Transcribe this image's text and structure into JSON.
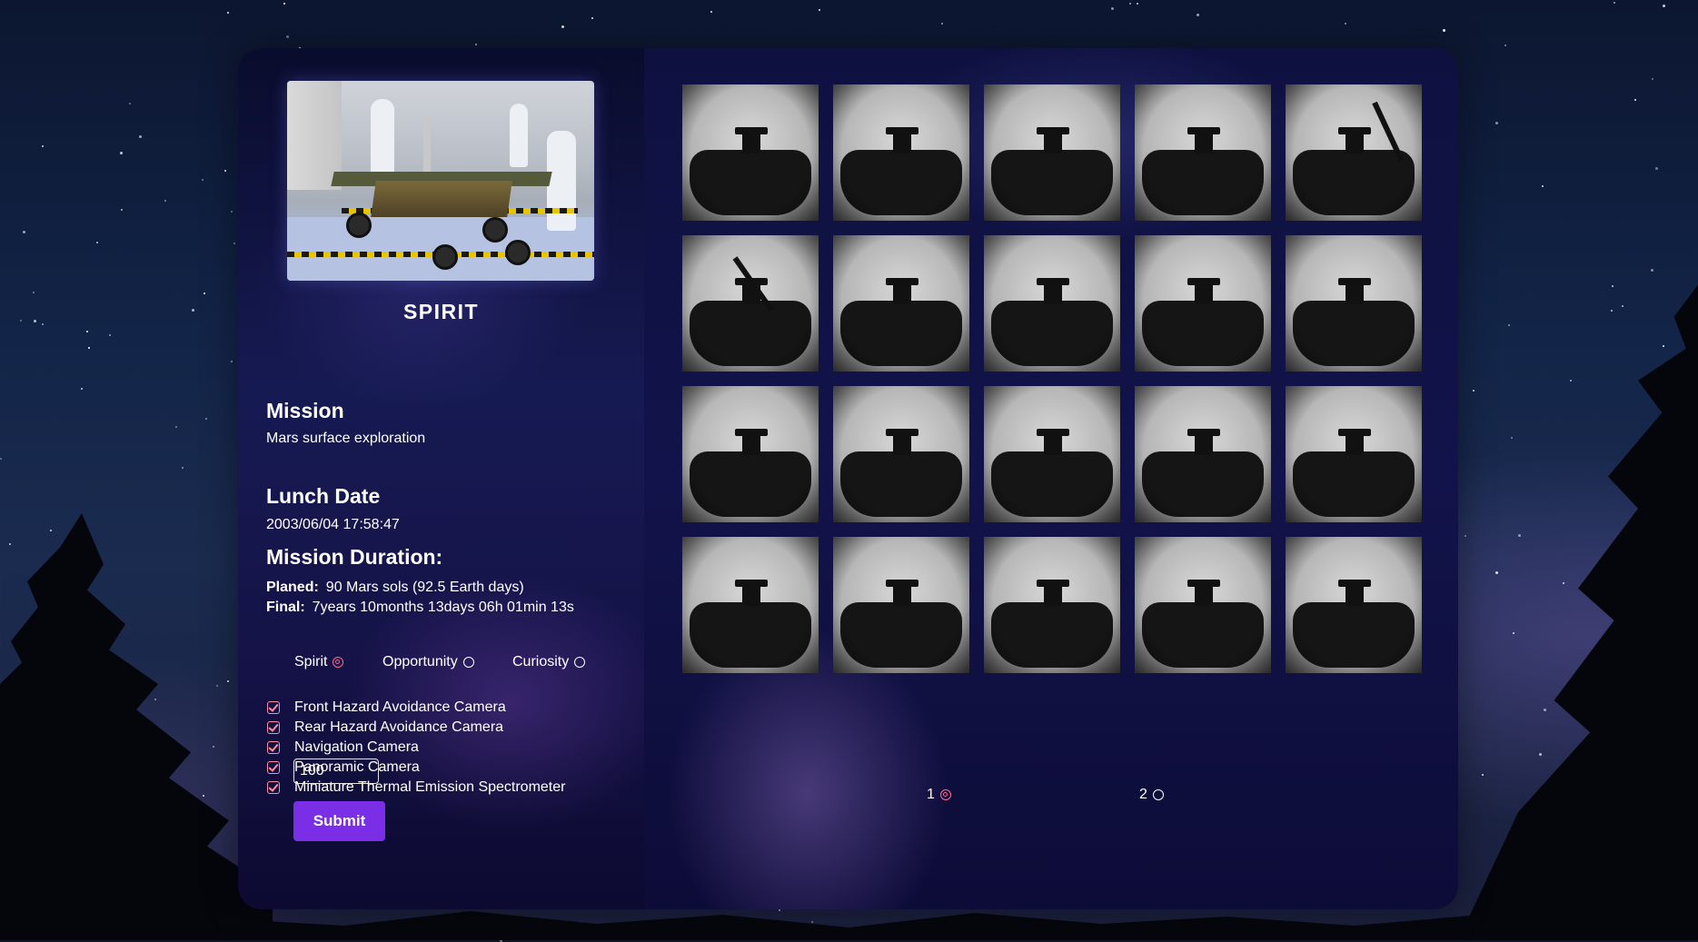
{
  "rover": {
    "name": "SPIRIT",
    "mission_heading": "Mission",
    "mission_text": "Mars surface exploration",
    "launch_heading": "Lunch Date",
    "launch_date": "2003/06/04 17:58:47",
    "duration_heading": "Mission Duration:",
    "planned_label": "Planed:",
    "planned_value": "90 Mars sols (92.5 Earth days)",
    "final_label": "Final:",
    "final_value": "7years 10months 13days 06h 01min 13s"
  },
  "rover_options": [
    {
      "label": "Spirit",
      "selected": true
    },
    {
      "label": "Opportunity",
      "selected": false
    },
    {
      "label": "Curiosity",
      "selected": false
    }
  ],
  "cameras": [
    {
      "label": "Front Hazard Avoidance Camera",
      "checked": true
    },
    {
      "label": "Rear Hazard Avoidance Camera",
      "checked": true
    },
    {
      "label": "Navigation Camera",
      "checked": true
    },
    {
      "label": "Panoramic Camera",
      "checked": true
    },
    {
      "label": "Miniature Thermal Emission Spectrometer",
      "checked": true
    }
  ],
  "sol_input": {
    "value": "100"
  },
  "submit_label": "Submit",
  "gallery": {
    "photo_count": 20,
    "columns": 5
  },
  "pagination": [
    {
      "label": "1",
      "selected": true
    },
    {
      "label": "2",
      "selected": false
    }
  ],
  "colors": {
    "accent": "#7a2ee6",
    "radio_selected": "#ff6a8a",
    "checkbox": "#ff8fa8"
  }
}
